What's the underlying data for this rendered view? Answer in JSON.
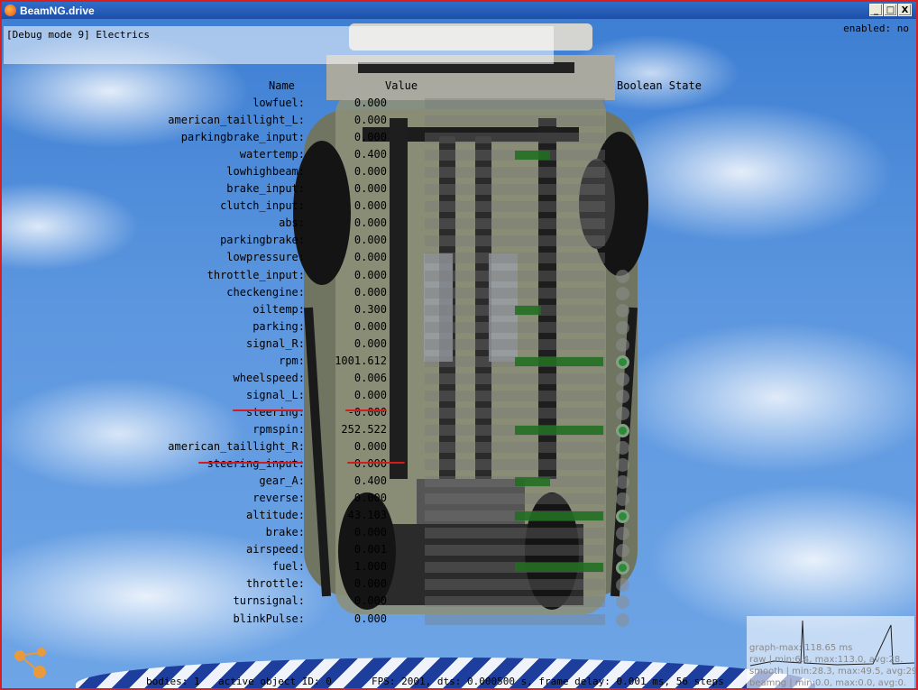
{
  "window": {
    "title": "BeamNG.drive",
    "minimize": "_",
    "maximize": "□",
    "close": "X"
  },
  "debug": {
    "mode_label": "[Debug mode 9] Electrics",
    "enabled_label": "enabled: no"
  },
  "columns": {
    "name": "Name",
    "value": "Value",
    "boolean": "Boolean State"
  },
  "rows": [
    {
      "name": "lowfuel:",
      "value": "0.000",
      "bar": 0,
      "bool": false
    },
    {
      "name": "american_taillight_L:",
      "value": "0.000",
      "bar": 0,
      "bool": false
    },
    {
      "name": "parkingbrake_input:",
      "value": "0.000",
      "bar": 0,
      "bool": false
    },
    {
      "name": "watertemp:",
      "value": "0.400",
      "bar": 0.4,
      "bool": false
    },
    {
      "name": "lowhighbeam:",
      "value": "0.000",
      "bar": 0,
      "bool": false
    },
    {
      "name": "brake_input:",
      "value": "0.000",
      "bar": 0,
      "bool": false
    },
    {
      "name": "clutch_input:",
      "value": "0.000",
      "bar": 0,
      "bool": false
    },
    {
      "name": "abs:",
      "value": "0.000",
      "bar": 0,
      "bool": false
    },
    {
      "name": "parkingbrake:",
      "value": "0.000",
      "bar": 0,
      "bool": false
    },
    {
      "name": "lowpressure:",
      "value": "0.000",
      "bar": 0,
      "bool": false
    },
    {
      "name": "throttle_input:",
      "value": "0.000",
      "bar": 0,
      "bool": false
    },
    {
      "name": "checkengine:",
      "value": "0.000",
      "bar": 0,
      "bool": false
    },
    {
      "name": "oiltemp:",
      "value": "0.300",
      "bar": 0.3,
      "bool": false
    },
    {
      "name": "parking:",
      "value": "0.000",
      "bar": 0,
      "bool": false
    },
    {
      "name": "signal_R:",
      "value": "0.000",
      "bar": 0,
      "bool": false
    },
    {
      "name": "rpm:",
      "value": "1001.612",
      "bar": 1,
      "bool": true
    },
    {
      "name": "wheelspeed:",
      "value": "0.006",
      "bar": 0,
      "bool": false
    },
    {
      "name": "signal_L:",
      "value": "0.000",
      "bar": 0,
      "bool": false
    },
    {
      "name": "steering:",
      "value": "-0.000",
      "bar": 0,
      "bool": false
    },
    {
      "name": "rpmspin:",
      "value": "252.522",
      "bar": 1,
      "bool": true
    },
    {
      "name": "american_taillight_R:",
      "value": "0.000",
      "bar": 0,
      "bool": false
    },
    {
      "name": "steering_input:",
      "value": "0.000",
      "bar": 0,
      "bool": false
    },
    {
      "name": "gear_A:",
      "value": "0.400",
      "bar": 0.4,
      "bool": false
    },
    {
      "name": "reverse:",
      "value": "0.000",
      "bar": 0,
      "bool": false
    },
    {
      "name": "altitude:",
      "value": "43.103",
      "bar": 1,
      "bool": true
    },
    {
      "name": "brake:",
      "value": "0.000",
      "bar": 0,
      "bool": false
    },
    {
      "name": "airspeed:",
      "value": "0.001",
      "bar": 0,
      "bool": false
    },
    {
      "name": "fuel:",
      "value": "1.000",
      "bar": 1,
      "bool": true
    },
    {
      "name": "throttle:",
      "value": "0.000",
      "bar": 0,
      "bool": false
    },
    {
      "name": "turnsignal:",
      "value": "0.000",
      "bar": 0,
      "bool": false
    },
    {
      "name": "blinkPulse:",
      "value": "0.000",
      "bar": 0,
      "bool": false
    }
  ],
  "graph": {
    "line1": "graph-max: 118.65 ms",
    "line2": "raw | min:6.4, max:113.0, avg:28.",
    "line3": "smooth | min:28.3, max:49.5, avg:29.",
    "line4": "beamng | min:0.0, max:0.0, avg:0."
  },
  "status": {
    "bodies": "bodies: 1",
    "object": "active object ID: 0",
    "perf": "FPS: 2001, dts: 0.000500 s, frame delay: 0.001 ms, 56 steps"
  },
  "colors": {
    "bar": "#1e6e1e",
    "bool_on": "#2d8a36",
    "annotation": "#d41a1a",
    "title_bar": "#2f6ec8"
  }
}
